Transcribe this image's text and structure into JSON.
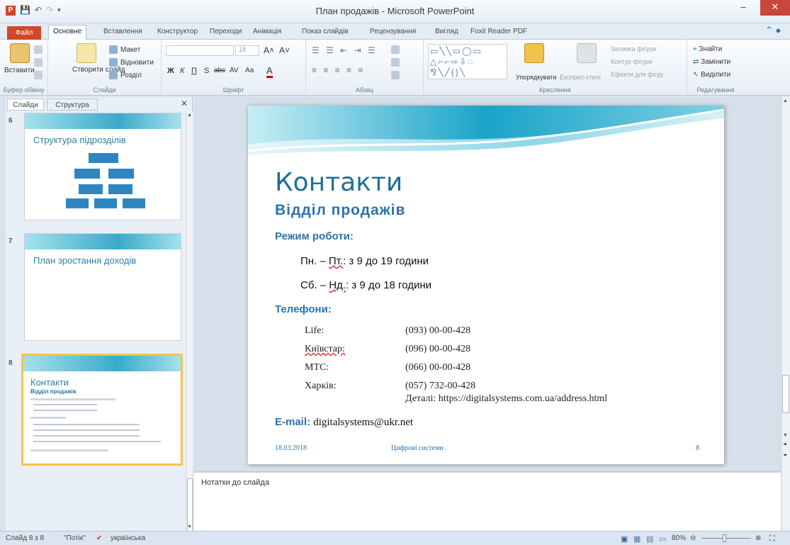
{
  "window": {
    "title": "План продажів - Microsoft PowerPoint",
    "minimize": "–",
    "maximize": "□",
    "close": "✕"
  },
  "ribbon_tabs": [
    "Файл",
    "Основне",
    "Вставлення",
    "Конструктор",
    "Переходи",
    "Анімація",
    "Показ слайдів",
    "Рецензування",
    "Вигляд",
    "Foxit Reader PDF"
  ],
  "ribbon": {
    "clipboard": {
      "paste": "Вставити",
      "label": "Буфер обміну"
    },
    "slides": {
      "new_slide": "Створити слайд",
      "layout": "Макет",
      "reset": "Відновити",
      "section": "Розділ",
      "label": "Слайди"
    },
    "font": {
      "size": "18",
      "label": "Шрифт",
      "bold": "Ж",
      "italic": "К",
      "underline": "П",
      "strike": "abc",
      "spacing": "AV",
      "case": "Aa",
      "color": "A"
    },
    "paragraph": {
      "label": "Абзац"
    },
    "drawing": {
      "arrange": "Упорядкувати",
      "quick_styles": "Експрес-стилі",
      "fill": "Заливка фігури",
      "outline": "Контур фігури",
      "effects": "Ефекти для фігур",
      "label": "Креслення"
    },
    "editing": {
      "find": "Знайти",
      "replace": "Замінити",
      "select": "Виділити",
      "label": "Редагування"
    }
  },
  "panel": {
    "tab_slides": "Слайди",
    "tab_outline": "Структура",
    "thumbnails": [
      {
        "number": "6",
        "title": "Структура підрозділів"
      },
      {
        "number": "7",
        "title": "План зростання доходів"
      },
      {
        "number": "8",
        "title": "Контакти",
        "subtitle": "Відділ продажів"
      }
    ]
  },
  "slide": {
    "title": "Контакти",
    "subtitle": "Відділ продажів",
    "hours_heading": "Режим роботи:",
    "hours": [
      {
        "prefix": "Пн. – ",
        "marked": "Пт.",
        "rest": ": з 9 до 19 години"
      },
      {
        "prefix": "Сб. – ",
        "marked": "Нд.",
        "rest": ": з 9 до 18 години"
      }
    ],
    "phones_heading": "Телефони:",
    "phones": [
      {
        "operator": "Life:",
        "number": "(093) 00-00-428"
      },
      {
        "operator": "Київстар:",
        "number": "(096) 00-00-428"
      },
      {
        "operator": "МТС:",
        "number": "(066) 00-00-428"
      },
      {
        "operator": "Харків:",
        "number": "(057) 732-00-428"
      }
    ],
    "details": "Деталі: https://digitalsystems.com.ua/address.html",
    "email_label": "E-mail:",
    "email": "digitalsystems@ukr.net",
    "footer_date": "18.03.2018",
    "footer_center": "Цифрові системи",
    "footer_page": "8"
  },
  "notes": {
    "placeholder": "Нотатки до слайда"
  },
  "status": {
    "slide_of": "Слайд 8 з 8",
    "theme": "\"Потік\"",
    "language": "українська",
    "zoom": "80%"
  },
  "colors": {
    "accent": "#2a7fb0",
    "heading": "#2b73ad",
    "file_tab": "#d24726"
  }
}
